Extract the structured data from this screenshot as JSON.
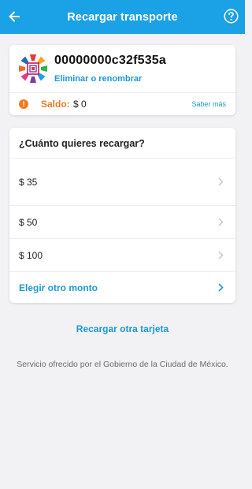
{
  "header": {
    "title": "Recargar transporte",
    "back_icon": "arrow-left-icon",
    "help_icon": "question-circle-icon",
    "color": "#1aa1e6"
  },
  "card": {
    "number": "00000000c32f535a",
    "rename_label": "Eliminar o renombrar",
    "balance_label": "Saldo:",
    "balance_value": "$ 0",
    "more_label": "Saber más",
    "warning_icon": "!"
  },
  "amounts": {
    "question": "¿Cuánto quieres recargar?",
    "options": [
      {
        "label": "$ 35"
      },
      {
        "label": "$ 50"
      },
      {
        "label": "$ 100"
      }
    ],
    "other_label": "Elegir otro monto"
  },
  "recharge_other_label": "Recargar otra tarjeta",
  "footer": "Servicio ofrecido por el Gobierno de la Ciudad de México.",
  "colors": {
    "accent": "#1aa1e6",
    "link": "#1a9ad6",
    "warning": "#f07c1e"
  }
}
